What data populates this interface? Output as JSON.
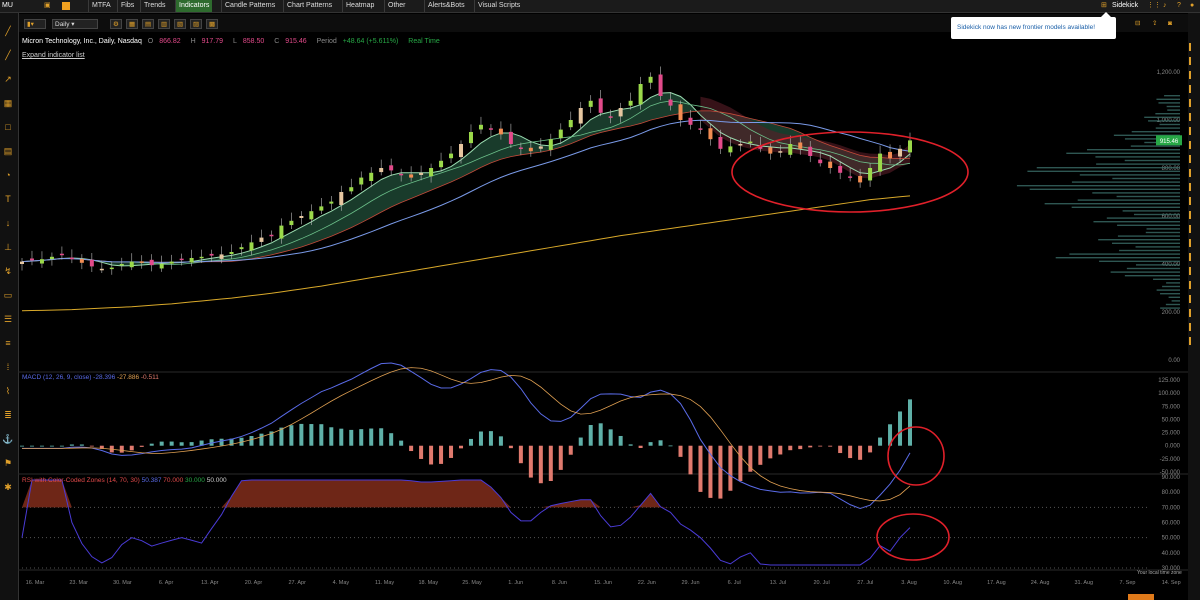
{
  "topbar": {
    "symbol": "MU",
    "menu": [
      "MTFA",
      "Fibs",
      "Trends",
      "Indicators",
      "Candle Patterns",
      "Chart Patterns",
      "Heatmap",
      "Other",
      "Alerts&Bots",
      "Visual Scripts"
    ],
    "active": "Indicators",
    "sidekick": "Sidekick"
  },
  "subbar": {
    "interval": "Daily"
  },
  "toast": {
    "text": "Sidekick now has new frontier models available!"
  },
  "info": {
    "title": "Micron Technology, Inc., Daily, Nasdaq",
    "o_label": "O",
    "o": "866.82",
    "h_label": "H",
    "h": "917.79",
    "l_label": "L",
    "l": "858.50",
    "c_label": "C",
    "c": "915.46",
    "period_label": "Period",
    "period": "+48.64 (+5.611%)",
    "realtime": "Real Time",
    "expand": "Expand indicator list"
  },
  "macd_header": {
    "label": "MACD (12, 26, 9, close)",
    "macd": "-28.396",
    "signal": "-27.886",
    "hist": "-0.511"
  },
  "rsi_header": {
    "label": "RSI with Color-Coded Zones (14, 70, 30)",
    "rsi": "50.387",
    "upper": "70.000",
    "lower": "30.000",
    "mid": "50.000"
  },
  "colors": {
    "bull": "#9bd94a",
    "bull_pale": "#e6c6a0",
    "bear": "#e24a8a",
    "bear_orange": "#f28c52",
    "price_tag": "#27a846",
    "annotation": "#e0202a",
    "sma200": "#d9a92a",
    "ribbon_green": "#2e6b4e",
    "ribbon_red": "#5a1e28",
    "macd_line": "#5a6be8",
    "signal_line": "#e0a052",
    "hist_pos": "#5fb0a8",
    "hist_neg": "#e07a6e",
    "rsi_line": "#4a3bd6",
    "rsi_zone": "#7a2a1a"
  },
  "chart_data": [
    {
      "type": "candlestick",
      "title": "Micron Technology, Inc., Daily, Nasdaq",
      "y_ticks": [
        "1,200.00",
        "1,000.00",
        "800.00",
        "600.00",
        "400.00",
        "200.00",
        "0.00"
      ],
      "ylim": [
        0,
        1250
      ],
      "last_price": "915.46",
      "x_ticks": [
        "16. Mar",
        "23. Mar",
        "30. Mar",
        "6. Apr",
        "13. Apr",
        "20. Apr",
        "27. Apr",
        "4. May",
        "11. May",
        "18. May",
        "25. May",
        "1. Jun",
        "8. Jun",
        "15. Jun",
        "22. Jun",
        "29. Jun",
        "6. Jul",
        "13. Jul",
        "20. Jul",
        "27. Jul",
        "3. Aug",
        "10. Aug",
        "17. Aug",
        "24. Aug",
        "31. Aug",
        "7. Sep",
        "14. Sep"
      ],
      "candles_close": [
        410,
        415,
        420,
        430,
        440,
        420,
        405,
        390,
        380,
        385,
        400,
        410,
        405,
        395,
        400,
        410,
        420,
        425,
        430,
        435,
        440,
        450,
        470,
        490,
        510,
        520,
        560,
        580,
        600,
        620,
        640,
        660,
        700,
        720,
        760,
        780,
        800,
        790,
        770,
        760,
        780,
        800,
        830,
        860,
        900,
        950,
        980,
        960,
        940,
        900,
        880,
        870,
        890,
        920,
        960,
        1000,
        1050,
        1080,
        1030,
        1010,
        1050,
        1080,
        1150,
        1180,
        1100,
        1060,
        1000,
        980,
        960,
        920,
        880,
        890,
        900,
        910,
        880,
        860,
        870,
        900,
        880,
        850,
        820,
        800,
        780,
        760,
        740,
        800,
        860,
        840,
        880,
        915
      ],
      "sma200": [
        205,
        206,
        207,
        208,
        209,
        210,
        212,
        214,
        216,
        218,
        220,
        222,
        225,
        228,
        231,
        234,
        238,
        242,
        246,
        250,
        254,
        258,
        263,
        268,
        273,
        278,
        284,
        290,
        296,
        302,
        308,
        315,
        322,
        329,
        336,
        343,
        350,
        357,
        364,
        371,
        378,
        385,
        392,
        399,
        406,
        413,
        420,
        427,
        434,
        441,
        448,
        455,
        462,
        469,
        476,
        483,
        490,
        497,
        504,
        511,
        518,
        524,
        530,
        536,
        542,
        548,
        554,
        560,
        566,
        572,
        578,
        584,
        590,
        596,
        602,
        608,
        614,
        620,
        626,
        632,
        638,
        644,
        650,
        656,
        662,
        668,
        672,
        676,
        680,
        684
      ],
      "volume_profile": "right-edge horizontal histogram"
    },
    {
      "type": "macd",
      "title": "MACD (12, 26, 9, close)",
      "y_ticks": [
        "125.000",
        "100.000",
        "75.000",
        "50.000",
        "25.000",
        "0.000",
        "-25.000",
        "-50.000"
      ],
      "ylim": [
        -50,
        125
      ],
      "macd": "-28.396",
      "signal": "-27.886",
      "histogram": "-0.511"
    },
    {
      "type": "rsi",
      "title": "RSI with Color-Coded Zones (14, 70, 30)",
      "y_ticks": [
        "90.000",
        "80.000",
        "70.000",
        "60.000",
        "50.000",
        "40.000",
        "30.000"
      ],
      "ylim": [
        30,
        90
      ],
      "rsi": "50.387",
      "levels": [
        70,
        50,
        30
      ]
    }
  ],
  "footer": {
    "timezone": "Your local time zone"
  }
}
